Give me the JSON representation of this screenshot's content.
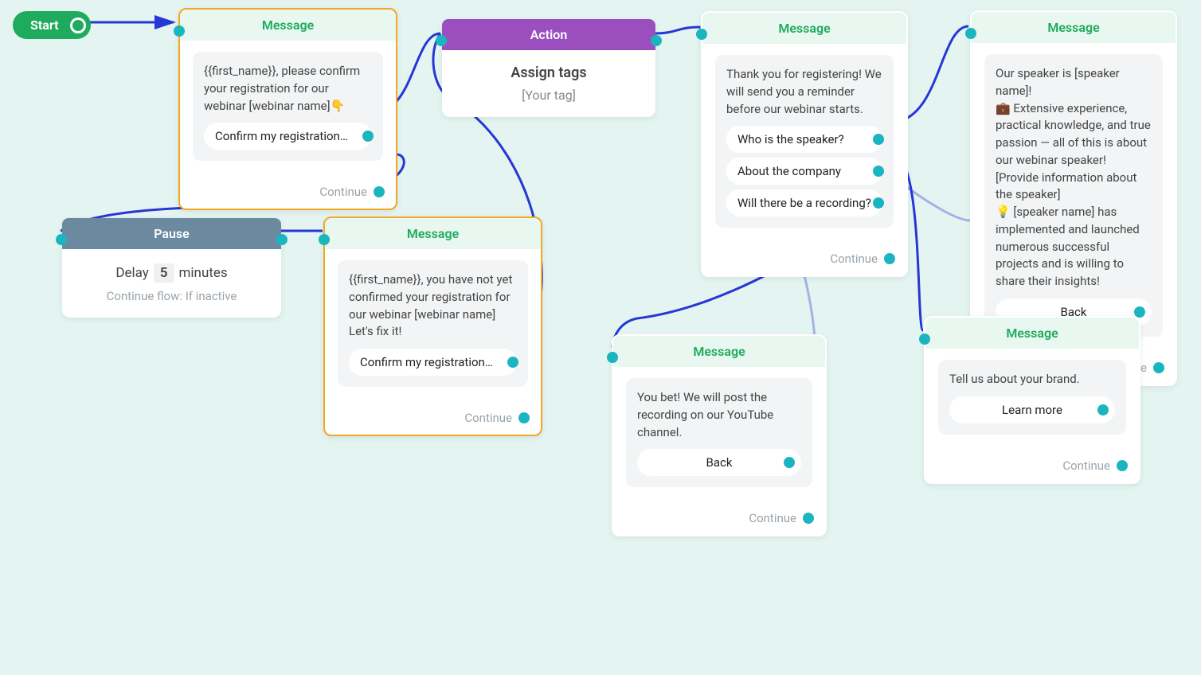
{
  "start": {
    "label": "Start"
  },
  "nodes": {
    "msg1": {
      "type": "Message",
      "text": "{{first_name}}, please confirm your registration for our webinar [webinar name]👇",
      "buttons": [
        {
          "label": "Confirm my registration …"
        }
      ],
      "continue": "Continue"
    },
    "action1": {
      "type": "Action",
      "title": "Assign tags",
      "tag": "[Your tag]"
    },
    "pause1": {
      "type": "Pause",
      "delay_label": "Delay",
      "delay_value": "5",
      "delay_unit": "minutes",
      "sub": "Continue flow: If inactive"
    },
    "msg2": {
      "type": "Message",
      "text": "{{first_name}}, you have not yet confirmed your registration for our webinar [webinar name]\nLet's fix it!",
      "buttons": [
        {
          "label": "Confirm my registration …"
        }
      ],
      "continue": "Continue"
    },
    "msg3": {
      "type": "Message",
      "text": "Thank you for registering! We will send you a reminder before our webinar starts.",
      "buttons": [
        {
          "label": "Who is the speaker?"
        },
        {
          "label": "About the company"
        },
        {
          "label": "Will there be a recording?"
        }
      ],
      "continue": "Continue"
    },
    "msg4": {
      "type": "Message",
      "text": "Our speaker is [speaker name]!\n💼  Extensive experience, practical knowledge, and true passion — all of this is about our webinar speaker! [Provide information about the speaker]\n💡  [speaker name] has implemented and launched numerous successful projects and is willing to share their insights!",
      "buttons": [
        {
          "label": "Back"
        }
      ],
      "continue": "Continue"
    },
    "msg5": {
      "type": "Message",
      "text": "You bet! We will post the recording on our YouTube channel.",
      "buttons": [
        {
          "label": "Back"
        }
      ],
      "continue": "Continue"
    },
    "msg6": {
      "type": "Message",
      "text": "Tell us about your brand.",
      "buttons": [
        {
          "label": "Learn more"
        }
      ],
      "continue": "Continue"
    }
  }
}
